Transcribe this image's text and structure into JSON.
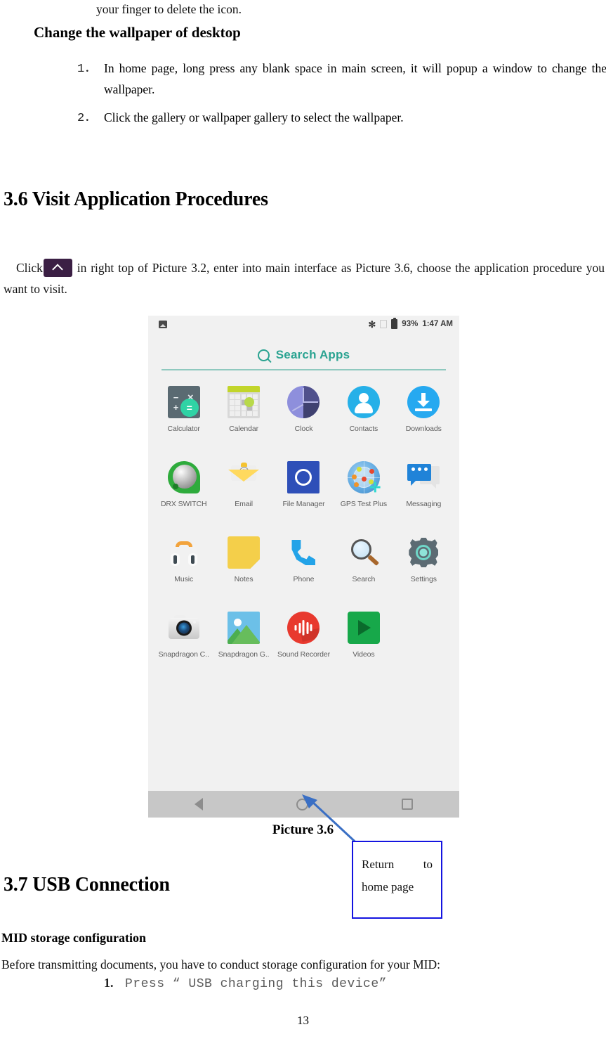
{
  "doc": {
    "page_number": "13",
    "continued_line": "your finger to delete the icon.",
    "wallpaper_heading": "Change the wallpaper of desktop",
    "wallpaper_steps": [
      {
        "marker": "1．",
        "text": "In home page, long press any blank space in main screen, it will popup a window to change the wallpaper."
      },
      {
        "marker": "2．",
        "text": "Click the gallery or wallpaper gallery to select the wallpaper."
      }
    ],
    "section_36_title": "3.6 Visit Application Procedures",
    "section_36_body_before": "Click",
    "section_36_body_after": "in right top of Picture 3.2, enter into main interface as Picture 3.6, choose the application procedure you want to visit.",
    "figure_caption": "Picture 3.6",
    "callout": {
      "line1_left": "Return",
      "line1_right": "to",
      "line2": "home page"
    },
    "section_37_title": "3.7 USB Connection",
    "usb_subheading": "MID storage configuration",
    "usb_body": "Before transmitting documents, you have to conduct storage configuration for your MID:",
    "usb_steps": [
      {
        "marker": "1.",
        "text": "Press “ USB charging this device”"
      }
    ]
  },
  "screenshot": {
    "statusbar": {
      "carrier": "",
      "image_icon": "image-icon",
      "bluetooth": "✻",
      "sim_icon": "sim-card-icon",
      "battery_icon": "battery-icon",
      "battery_percent": "93%",
      "clock": "1:47 AM"
    },
    "search": {
      "icon": "search-icon",
      "label": "Search Apps",
      "accent_color": "#2aa391"
    },
    "apps": [
      {
        "label": "Calculator",
        "icon": "calculator-icon",
        "cls": "ic-calculator"
      },
      {
        "label": "Calendar",
        "icon": "calendar-icon",
        "cls": "ic-calendar"
      },
      {
        "label": "Clock",
        "icon": "clock-icon",
        "cls": "ic-clock"
      },
      {
        "label": "Contacts",
        "icon": "contacts-icon",
        "cls": "ic-contacts"
      },
      {
        "label": "Downloads",
        "icon": "downloads-icon",
        "cls": "ic-downloads"
      },
      {
        "label": "DRX SWITCH",
        "icon": "drx-switch-icon",
        "cls": "ic-drx"
      },
      {
        "label": "Email",
        "icon": "email-icon",
        "cls": "ic-email"
      },
      {
        "label": "File Manager",
        "icon": "file-manager-icon",
        "cls": "ic-filemanager"
      },
      {
        "label": "GPS Test Plus",
        "icon": "gps-test-plus-icon",
        "cls": "ic-gps"
      },
      {
        "label": "Messaging",
        "icon": "messaging-icon",
        "cls": "ic-messaging"
      },
      {
        "label": "Music",
        "icon": "music-icon",
        "cls": "ic-music"
      },
      {
        "label": "Notes",
        "icon": "notes-icon",
        "cls": "ic-notes"
      },
      {
        "label": "Phone",
        "icon": "phone-icon",
        "cls": "ic-phone"
      },
      {
        "label": "Search",
        "icon": "search-magnifier-icon",
        "cls": "ic-search"
      },
      {
        "label": "Settings",
        "icon": "settings-gear-icon",
        "cls": "ic-settings"
      },
      {
        "label": "Snapdragon C..",
        "icon": "snapdragon-camera-icon",
        "cls": "ic-snapcam"
      },
      {
        "label": "Snapdragon G..",
        "icon": "snapdragon-gallery-icon",
        "cls": "ic-snapgal"
      },
      {
        "label": "Sound Recorder",
        "icon": "sound-recorder-icon",
        "cls": "ic-sound"
      },
      {
        "label": "Videos",
        "icon": "videos-icon",
        "cls": "ic-videos"
      }
    ],
    "navbar": [
      {
        "name": "back-button",
        "icon": "back-triangle-icon"
      },
      {
        "name": "home-button",
        "icon": "home-circle-icon"
      },
      {
        "name": "recents-button",
        "icon": "recents-square-icon"
      }
    ]
  }
}
